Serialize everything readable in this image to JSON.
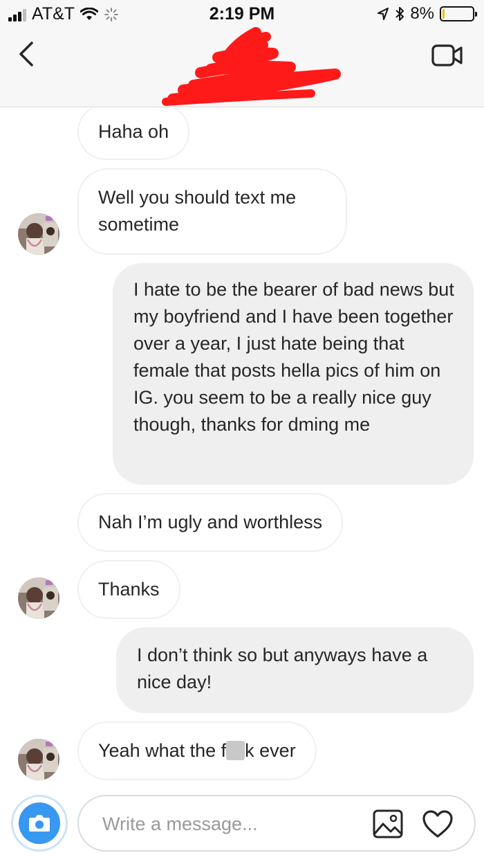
{
  "status_bar": {
    "carrier": "AT&T",
    "time": "2:19 PM",
    "battery": "8%",
    "battery_level": 0.08,
    "icons": [
      "signal-icon",
      "wifi-icon",
      "activity-spinner-icon",
      "location-arrow-icon",
      "bluetooth-icon",
      "battery-icon"
    ]
  },
  "header": {
    "icons": [
      "back-chevron-icon",
      "video-call-icon"
    ]
  },
  "messages": [
    {
      "direction": "incoming",
      "text": "Haha oh"
    },
    {
      "direction": "incoming",
      "text": "Well you should text me sometime"
    },
    {
      "direction": "outgoing",
      "text": "I hate to be the bearer of bad news but my boyfriend and I have been together over a year, I just hate being that female that posts hella pics of him on IG. you seem to be a really nice guy though, thanks for dming me"
    },
    {
      "direction": "incoming",
      "text": "Nah I’m ugly and worthless"
    },
    {
      "direction": "incoming",
      "text": "Thanks"
    },
    {
      "direction": "outgoing",
      "text": "I don’t think so but anyways have a nice day!"
    },
    {
      "direction": "incoming",
      "text_before": "Yeah what the f",
      "text_after": "k ever"
    }
  ],
  "composer": {
    "placeholder": "Write a message...",
    "value": "",
    "icons": [
      "camera-icon",
      "gallery-icon",
      "heart-icon"
    ]
  },
  "colors": {
    "accent_blue": "#3897f0",
    "outgoing_bubble": "#efefef",
    "incoming_border": "#efefef",
    "redaction": "#ff0000",
    "battery_low": "#e9c300"
  }
}
